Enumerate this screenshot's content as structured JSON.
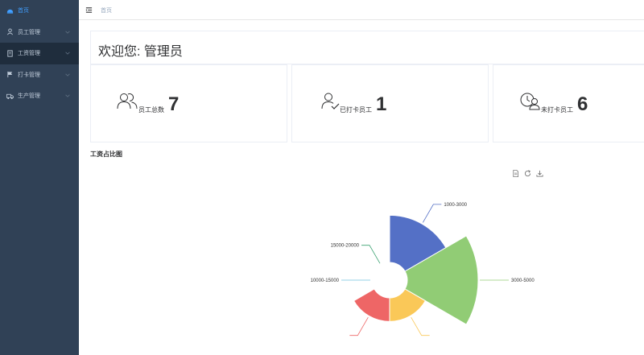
{
  "sidebar": {
    "items": [
      {
        "label": "首页",
        "icon": "dashboard-icon"
      },
      {
        "label": "员工管理",
        "icon": "user-icon"
      },
      {
        "label": "工资管理",
        "icon": "document-icon"
      },
      {
        "label": "打卡管理",
        "icon": "flag-icon"
      },
      {
        "label": "生产管理",
        "icon": "truck-icon"
      }
    ]
  },
  "navbar": {
    "breadcrumb": "首页"
  },
  "welcome": {
    "title": "欢迎您: 管理员"
  },
  "stats": [
    {
      "label": "员工总数",
      "value": "7",
      "icon": "users-icon"
    },
    {
      "label": "已打卡员工",
      "value": "1",
      "icon": "user-check-icon"
    },
    {
      "label": "未打卡员工",
      "value": "6",
      "icon": "user-clock-icon"
    }
  ],
  "chart_title": "工资占比图",
  "toolbox": [
    "data-view-icon",
    "restore-icon",
    "save-image-icon"
  ],
  "colors": {
    "sidebar": "#304156",
    "active": "#409eff",
    "blue": "#5470c6",
    "green": "#91cc75",
    "yellow": "#fac858",
    "red": "#ee6666",
    "teal": "#73c0de"
  },
  "chart_data": {
    "type": "pie",
    "rose_type": "radius",
    "slices": [
      {
        "name": "1000-3000",
        "value": 2,
        "color": "#5470c6"
      },
      {
        "name": "3000-5000",
        "value": 3,
        "color": "#91cc75"
      },
      {
        "name": "",
        "value": 1,
        "color": "#fac858"
      },
      {
        "name": "",
        "value": 1,
        "color": "#ee6666"
      },
      {
        "name": "10000-15000",
        "value": 0,
        "color": "#73c0de"
      },
      {
        "name": "15000-20000",
        "value": 0,
        "color": "#3ba272"
      }
    ]
  }
}
